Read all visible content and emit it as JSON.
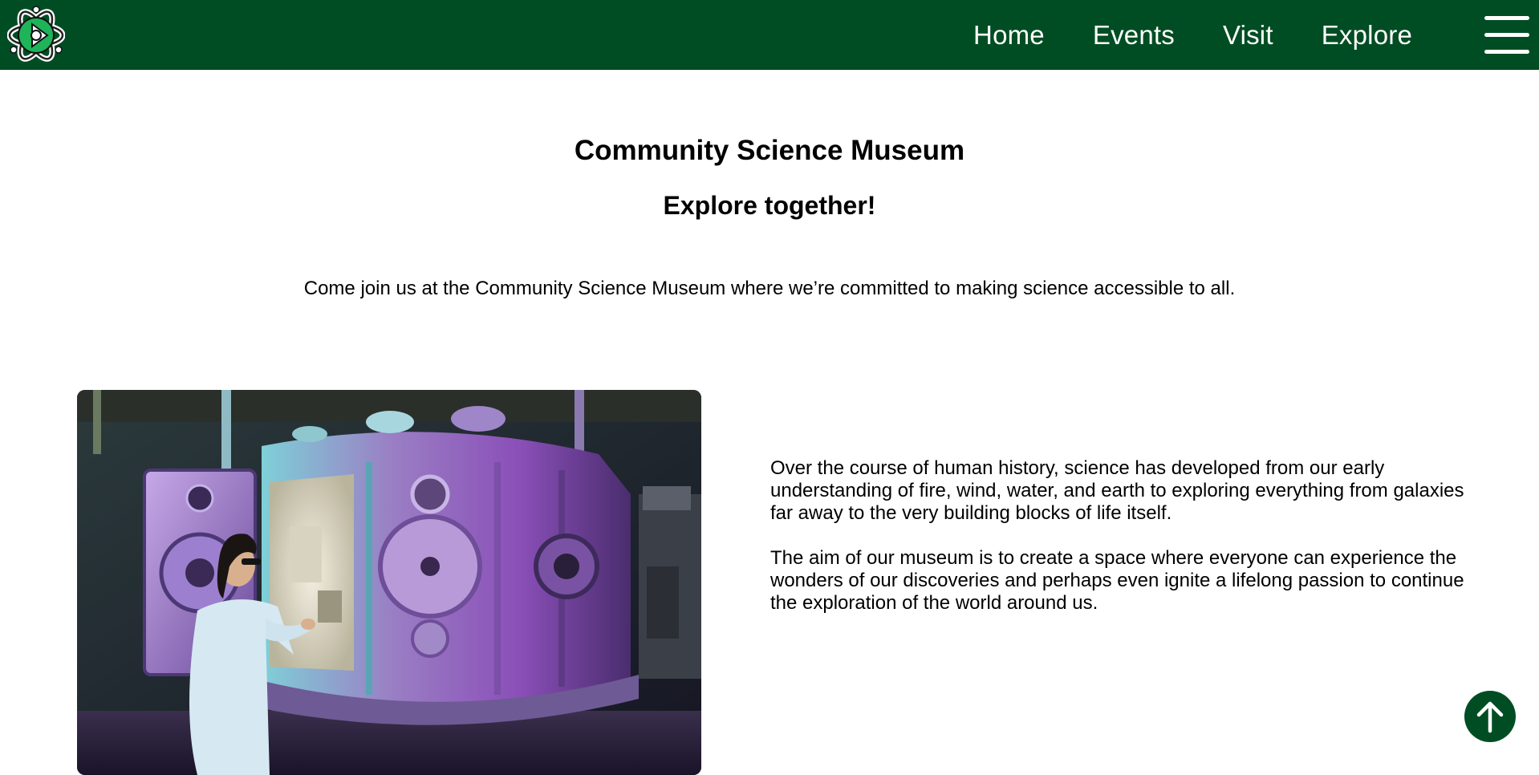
{
  "header": {
    "logo_icon": "atom-play-logo-icon",
    "nav": [
      {
        "label": "Home"
      },
      {
        "label": "Events"
      },
      {
        "label": "Visit"
      },
      {
        "label": "Explore"
      }
    ],
    "menu_icon": "hamburger-menu-icon",
    "background_color": "#004d24"
  },
  "main": {
    "title": "Community Science Museum",
    "subtitle": "Explore together!",
    "intro": "Come join us at the Community Science Museum where we’re committed to making science accessible to all.",
    "about": [
      "Over the course of human history, science has developed from our early understanding of fire, wind, water, and earth to exploring everything from galaxies far away to the very building blocks of life itself.",
      "The aim of our museum is to create a space where everyone can experience the wonders of our discoveries and perhaps even ignite a lifelong passion to continue the exploration of the world around us."
    ]
  },
  "scroll_top_icon": "arrow-up-icon",
  "accent_color": "#004d24"
}
